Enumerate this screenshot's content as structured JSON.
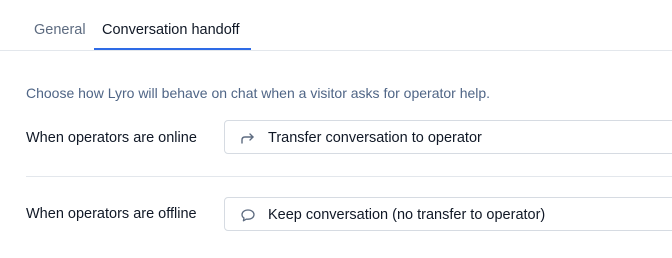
{
  "tabs": [
    {
      "label": "General",
      "active": false
    },
    {
      "label": "Conversation handoff",
      "active": true
    }
  ],
  "description": "Choose how Lyro will behave on chat when a visitor asks for operator help.",
  "settings": {
    "online": {
      "label": "When operators are online",
      "selected_value": "Transfer conversation to operator",
      "icon": "forward-arrow-icon"
    },
    "offline": {
      "label": "When operators are offline",
      "selected_value": "Keep conversation (no transfer to operator)",
      "icon": "chat-bubble-icon"
    }
  },
  "colors": {
    "accent": "#2e6be6",
    "description_text": "#4f6586",
    "border": "#d6dbe2"
  }
}
